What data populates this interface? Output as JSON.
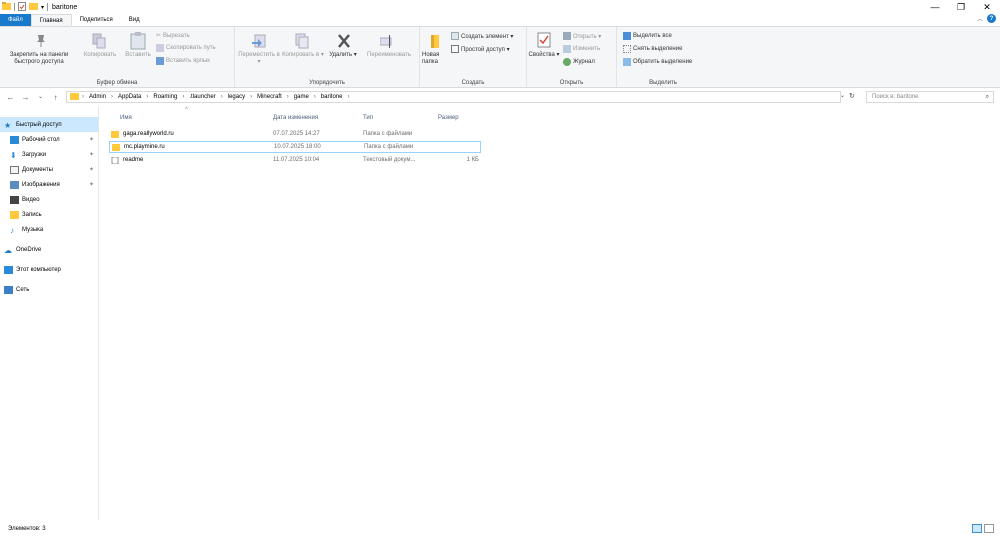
{
  "window": {
    "title": "baritone",
    "minimize": "—",
    "maximize": "❐",
    "close": "✕"
  },
  "tabs": {
    "file": "Файл",
    "home": "Главная",
    "share": "Поделиться",
    "view": "Вид"
  },
  "ribbon": {
    "clipboard": {
      "label": "Буфер обмена",
      "pin": "Закрепить на панели быстрого доступа",
      "copy": "Копировать",
      "paste": "Вставить",
      "cut": "Вырезать",
      "copy_path": "Скопировать путь",
      "paste_shortcut": "Вставить ярлык"
    },
    "organize": {
      "label": "Упорядочить",
      "move": "Переместить в ▾",
      "copy_to": "Копировать в ▾",
      "delete": "Удалить ▾",
      "rename": "Переименовать"
    },
    "new": {
      "label": "Создать",
      "new_folder": "Новая папка",
      "new_item": "Создать элемент ▾",
      "easy_access": "Простой доступ ▾"
    },
    "open": {
      "label": "Открыть",
      "properties": "Свойства ▾",
      "open": "Открыть ▾",
      "edit": "Изменить",
      "history": "Журнал"
    },
    "select": {
      "label": "Выделить",
      "select_all": "Выделить все",
      "select_none": "Снять выделение",
      "invert": "Обратить выделение"
    }
  },
  "address": {
    "crumbs": [
      "Admin",
      "AppData",
      "Roaming",
      ".tlauncher",
      "legacy",
      "Minecraft",
      "game",
      "baritone"
    ],
    "search_placeholder": "Поиск в: baritone"
  },
  "nav_pane": {
    "quick_access": "Быстрый доступ",
    "desktop": "Рабочий стол",
    "downloads": "Загрузки",
    "documents": "Документы",
    "pictures": "Изображения",
    "videos": "Видео",
    "record": "Запись",
    "music": "Музыка",
    "onedrive": "OneDrive",
    "this_pc": "Этот компьютер",
    "network": "Сеть"
  },
  "columns": {
    "name": "Имя",
    "date": "Дата изменения",
    "type": "Тип",
    "size": "Размер"
  },
  "files": [
    {
      "name": "gaga.reallyworld.ru",
      "date": "07.07.2025 14:27",
      "type": "Папка с файлами",
      "size": ""
    },
    {
      "name": "mc.playmine.ru",
      "date": "10.07.2025 18:00",
      "type": "Папка с файлами",
      "size": ""
    },
    {
      "name": "readme",
      "date": "11.07.2025 10:04",
      "type": "Текстовый докум...",
      "size": "1 КБ"
    }
  ],
  "status": {
    "items": "Элементов: 3"
  },
  "colors": {
    "accent": "#1979ca",
    "folder": "#ffc83d",
    "selected": "#cce8ff"
  }
}
